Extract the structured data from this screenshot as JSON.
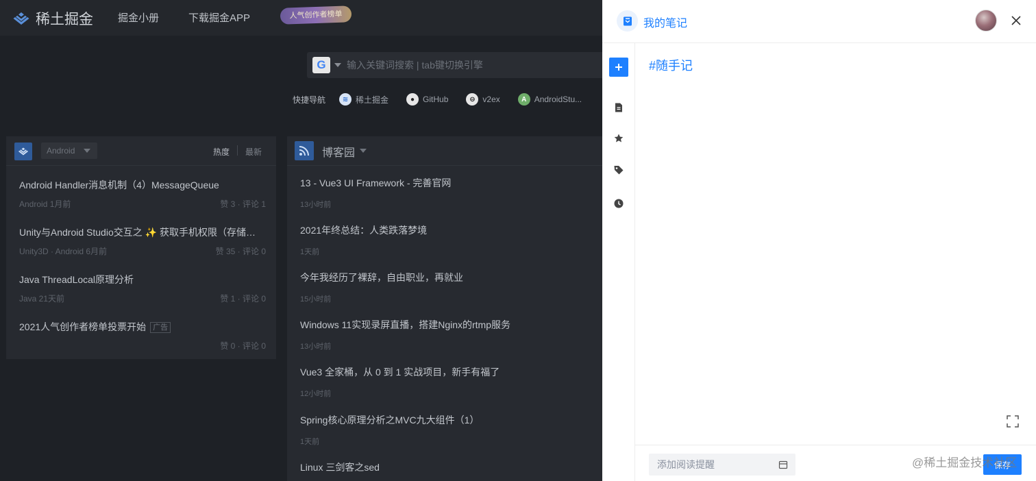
{
  "colors": {
    "accent": "#1e80ff",
    "background": "#1e2126",
    "panel": "#ffffff"
  },
  "topbar": {
    "brand": "稀土掘金",
    "nav": [
      "掘金小册",
      "下载掘金APP"
    ],
    "promo": "人气创作者榜单"
  },
  "search": {
    "placeholder": "输入关键词搜索 | tab键切换引擎",
    "engine_icon": "google-icon"
  },
  "quicknav": {
    "label": "快捷导航",
    "items": [
      {
        "label": "稀土掘金",
        "icon": "juejin-icon"
      },
      {
        "label": "GitHub",
        "icon": "github-icon"
      },
      {
        "label": "v2ex",
        "icon": "v2ex-icon"
      },
      {
        "label": "AndroidStu...",
        "icon": "android-studio-icon"
      }
    ]
  },
  "juejin_card": {
    "category": "Android",
    "sort": [
      "热度",
      "最新"
    ],
    "articles": [
      {
        "title": "Android Handler消息机制（4）MessageQueue",
        "meta": "Android  1月前",
        "stats": "赞 3 · 评论 1"
      },
      {
        "title": "Unity与Android Studio交互之 ✨ 获取手机权限（存储…",
        "meta": "Unity3D · Android  6月前",
        "stats": "赞 35 · 评论 0"
      },
      {
        "title": "Java ThreadLocal原理分析",
        "meta": "Java  21天前",
        "stats": "赞 1 · 评论 0"
      },
      {
        "title": "2021人气创作者榜单投票开始",
        "tag": "广告",
        "meta": "",
        "stats": "赞 0 · 评论 0"
      }
    ]
  },
  "feed_card": {
    "title": "博客园",
    "items": [
      {
        "title": "13 - Vue3 UI Framework - 完善官网",
        "time": "13小时前"
      },
      {
        "title": "2021年终总结：人类跌落梦境",
        "time": "1天前"
      },
      {
        "title": "今年我经历了裸辞，自由职业，再就业",
        "time": "15小时前"
      },
      {
        "title": "Windows 11实现录屏直播，搭建Nginx的rtmp服务",
        "time": "13小时前"
      },
      {
        "title": "Vue3 全家桶，从 0 到 1 实战项目，新手有福了",
        "time": "12小时前"
      },
      {
        "title": "Spring核心原理分析之MVC九大组件（1）",
        "time": "1天前"
      },
      {
        "title": "Linux 三剑客之sed",
        "time": ""
      }
    ]
  },
  "notes_panel": {
    "title": "我的笔记",
    "tag": "#随手记",
    "remind_placeholder": "添加阅读提醒",
    "save_label": "保存",
    "side_icons": [
      "add-icon",
      "note-icon",
      "star-icon",
      "tag-icon",
      "clock-icon"
    ]
  },
  "watermark": "@稀土掘金技术社区"
}
